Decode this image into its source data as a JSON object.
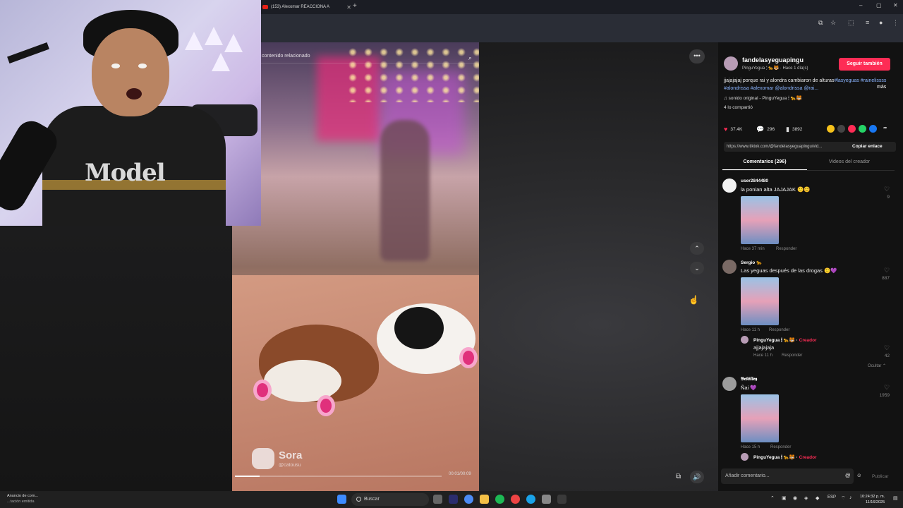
{
  "browser": {
    "tab_title": "(153) Alexomar REACCIONA A",
    "new_tab": "+",
    "window_controls": [
      "–",
      "▢",
      "✕"
    ]
  },
  "video": {
    "search_placeholder": "contenido relacionado",
    "watermark_name": "Sora",
    "watermark_user": "@catousu",
    "time": "00:01/00:09",
    "progress": 0.12
  },
  "panel": {
    "username": "fandelasyeguapingu",
    "subline": "PinguYegua 🕯 🐆🐯 · Hace 1 día(s)",
    "follow_label": "Seguir también",
    "description_text": "jjajajajaj porque rai y alondra cambiaron de alturas",
    "description_tags": "#lasyeguas #rainelissss #alondrissa #alexomar @alondrissa @rai...",
    "more_label": "más",
    "sound": "♫  sonido original - PinguYegua 🕯 🐆🐯",
    "shared": "4 lo compartió",
    "stats": {
      "likes": "37.4K",
      "comments": "296",
      "saves": "3892"
    },
    "link": "https://www.tiktok.com/@fandelasyeguapingu/vid...",
    "copy_label": "Copiar enlace",
    "tab_comments": "Comentarios (296)",
    "tab_creator": "Videos del creador",
    "comments": [
      {
        "name": "user2844480",
        "text": "la ponian alta JAJAJAK 🙂😊",
        "time": "Hace 37 min",
        "reply": "Responder",
        "likes": "9"
      },
      {
        "name": "Sergio 🐆",
        "text": "Las yeguas después de las drogas 🙂💜",
        "time": "Hace 11 h",
        "reply": "Responder",
        "likes": "887",
        "reply_item": {
          "name": "PinguYegua 🕯 🐆🐯 ·",
          "creator": "Creador",
          "text": "ajjajajaja",
          "time": "Hace 11 h",
          "reply": "Responder",
          "likes": "42"
        },
        "hide": "Ocultar ⌃"
      },
      {
        "name": "𝕭𝖊𝕶𝖎𝖑𝖑𝖊𝖞",
        "text": "Ñai 💜",
        "time": "Hace 15 h",
        "reply": "Responder",
        "likes": "1959",
        "reply_item": {
          "name": "PinguYegua 🕯 🐆🐯 ·",
          "creator": "Creador"
        }
      }
    ],
    "input_placeholder": "Añadir comentario...",
    "post_label": "Publicar"
  },
  "taskbar": {
    "news_title": "Anuncio de com...",
    "news_sub": "...tación emitida",
    "search_label": "Buscar",
    "lang": "ESP",
    "time": "10:24:32 p. m.",
    "date": "11/16/2025"
  },
  "cam": {
    "shirt_text": "Model"
  },
  "colors": {
    "accent": "#fe2c55",
    "tag": "#8ab4ff",
    "panel_bg": "#121212"
  }
}
